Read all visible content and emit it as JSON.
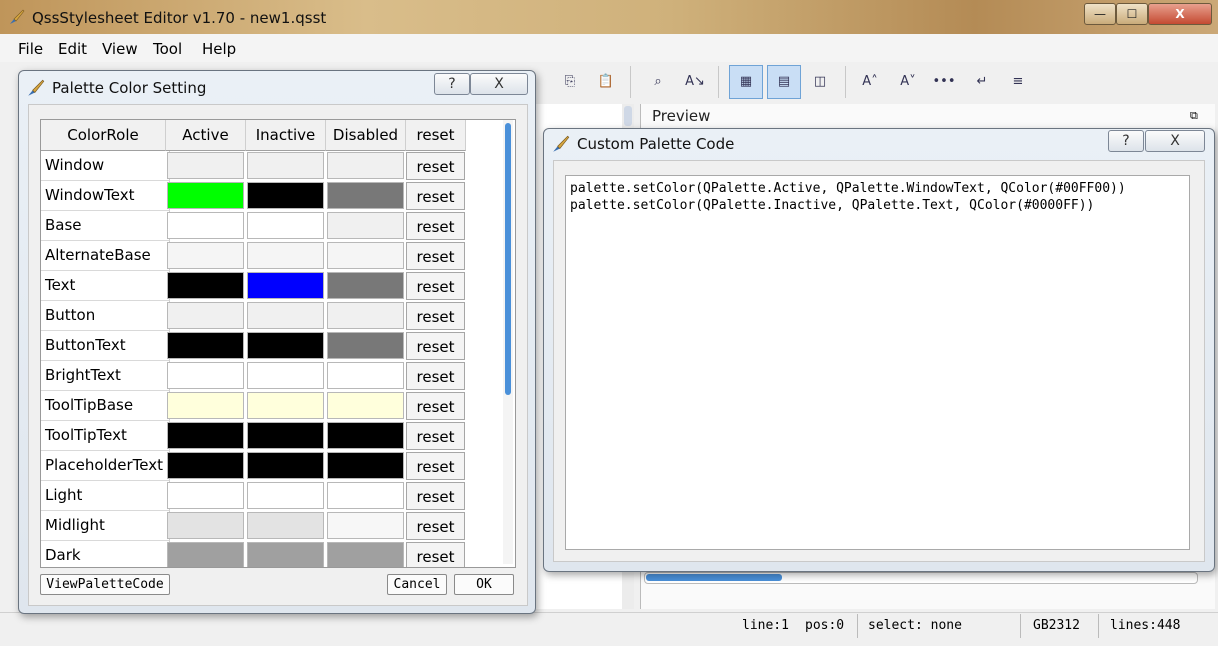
{
  "app": {
    "title": "QssStylesheet Editor v1.70 - new1.qsst",
    "caption_buttons": {
      "minimize": "—",
      "maximize": "☐",
      "close": "X"
    }
  },
  "menu": [
    "File",
    "Edit",
    "View",
    "Tool",
    "Help"
  ],
  "toolbar_icons": [
    "copy-icon",
    "paste-icon",
    "find-icon",
    "replace-icon",
    "palette-grid-icon",
    "layout-icon",
    "frame-icon",
    "font-increase-icon",
    "font-decrease-icon",
    "more-icon",
    "wrap-icon",
    "align-icon"
  ],
  "preview": {
    "title": "Preview"
  },
  "palette_dialog": {
    "title": "Palette Color Setting",
    "help_label": "?",
    "close_label": "X",
    "columns": [
      "ColorRole",
      "Active",
      "Inactive",
      "Disabled",
      "reset"
    ],
    "rows": [
      {
        "role": "Window",
        "active": "#f0f0f0",
        "inactive": "#f0f0f0",
        "disabled": "#f0f0f0",
        "reset": "reset"
      },
      {
        "role": "WindowText",
        "active": "#00ff00",
        "inactive": "#000000",
        "disabled": "#787878",
        "reset": "reset"
      },
      {
        "role": "Base",
        "active": "#ffffff",
        "inactive": "#ffffff",
        "disabled": "#f0f0f0",
        "reset": "reset"
      },
      {
        "role": "AlternateBase",
        "active": "#f5f5f5",
        "inactive": "#f5f5f5",
        "disabled": "#f5f5f5",
        "reset": "reset"
      },
      {
        "role": "Text",
        "active": "#000000",
        "inactive": "#0000ff",
        "disabled": "#787878",
        "reset": "reset"
      },
      {
        "role": "Button",
        "active": "#f0f0f0",
        "inactive": "#f0f0f0",
        "disabled": "#f0f0f0",
        "reset": "reset"
      },
      {
        "role": "ButtonText",
        "active": "#000000",
        "inactive": "#000000",
        "disabled": "#787878",
        "reset": "reset"
      },
      {
        "role": "BrightText",
        "active": "#ffffff",
        "inactive": "#ffffff",
        "disabled": "#ffffff",
        "reset": "reset"
      },
      {
        "role": "ToolTipBase",
        "active": "#ffffdc",
        "inactive": "#ffffdc",
        "disabled": "#ffffdc",
        "reset": "reset"
      },
      {
        "role": "ToolTipText",
        "active": "#000000",
        "inactive": "#000000",
        "disabled": "#000000",
        "reset": "reset"
      },
      {
        "role": "PlaceholderText",
        "active": "#000000",
        "inactive": "#000000",
        "disabled": "#000000",
        "reset": "reset"
      },
      {
        "role": "Light",
        "active": "#ffffff",
        "inactive": "#ffffff",
        "disabled": "#ffffff",
        "reset": "reset"
      },
      {
        "role": "Midlight",
        "active": "#e3e3e3",
        "inactive": "#e3e3e3",
        "disabled": "#f7f7f7",
        "reset": "reset"
      },
      {
        "role": "Dark",
        "active": "#a0a0a0",
        "inactive": "#a0a0a0",
        "disabled": "#a0a0a0",
        "reset": "reset"
      }
    ],
    "view_code_label": "ViewPaletteCode",
    "cancel_label": "Cancel",
    "ok_label": "OK"
  },
  "code_dialog": {
    "title": "Custom Palette Code",
    "help_label": "?",
    "close_label": "X",
    "lines": [
      "palette.setColor(QPalette.Active, QPalette.WindowText, QColor(#00FF00))",
      "palette.setColor(QPalette.Inactive, QPalette.Text, QColor(#0000FF))"
    ]
  },
  "status": {
    "line": "line:1",
    "pos": "pos:0",
    "select": "select: none",
    "encoding": "GB2312",
    "lines": "lines:448"
  }
}
